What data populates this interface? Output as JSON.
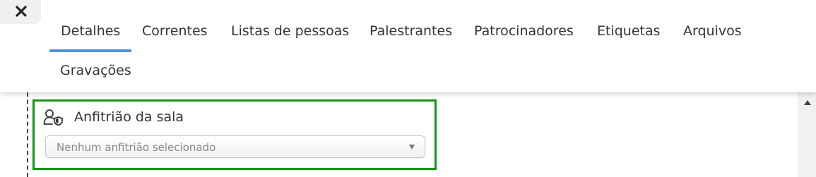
{
  "close_icon": "close-x-icon",
  "tabs": [
    {
      "label": "Detalhes",
      "active": true
    },
    {
      "label": "Correntes",
      "active": false
    },
    {
      "label": "Listas de pessoas",
      "active": false
    },
    {
      "label": "Palestrantes",
      "active": false
    },
    {
      "label": "Patrocinadores",
      "active": false
    },
    {
      "label": "Etiquetas",
      "active": false
    },
    {
      "label": "Arquivos",
      "active": false
    },
    {
      "label": "Gravações",
      "active": false
    }
  ],
  "room_host": {
    "icon": "user-shield-icon",
    "label": "Anfitrião da sala",
    "select": {
      "value": "Nenhum anfitrião selecionado"
    }
  },
  "colors": {
    "active_tab_underline": "#4a90d9",
    "highlight_border": "#149414"
  }
}
